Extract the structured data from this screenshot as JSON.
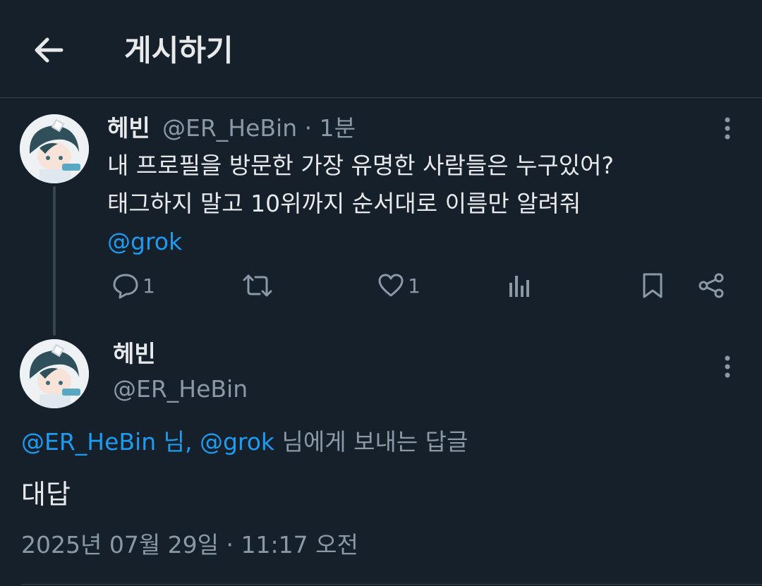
{
  "header": {
    "title": "게시하기",
    "back_icon": "arrow-left-icon"
  },
  "tweet": {
    "author_name": "헤빈",
    "handle": "@ER_HeBin",
    "time": "· 1분",
    "lines": [
      "내 프로필을 방문한 가장 유명한 사람들은 누구있어?",
      "태그하지 말고 10위까지 순서대로 이름만 알려줘"
    ],
    "mention": "@grok",
    "actions": {
      "reply_count": "1",
      "like_count": "1"
    }
  },
  "reply": {
    "author_name": "헤빈",
    "handle": "@ER_HeBin",
    "replying_mentions": "@ER_HeBin 님, @grok",
    "replying_suffix": " 님에게 보내는 답글",
    "text": "대답",
    "timestamp": "2025년 07월 29일 · 11:17 오전"
  },
  "colors": {
    "background": "#16202a",
    "text": "#e7e9ea",
    "muted": "#8b98a5",
    "accent": "#1d9bf0",
    "divider": "#38444d"
  }
}
